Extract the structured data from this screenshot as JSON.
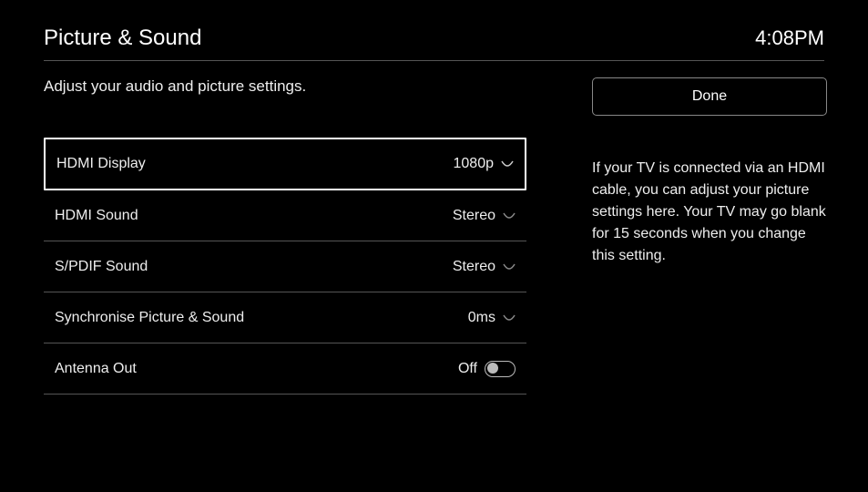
{
  "header": {
    "title": "Picture & Sound",
    "clock": "4:08PM"
  },
  "subtitle": "Adjust your audio and picture settings.",
  "settings": {
    "hdmi_display": {
      "label": "HDMI Display",
      "value": "1080p"
    },
    "hdmi_sound": {
      "label": "HDMI Sound",
      "value": "Stereo"
    },
    "spdif_sound": {
      "label": "S/PDIF Sound",
      "value": "Stereo"
    },
    "sync": {
      "label": "Synchronise Picture & Sound",
      "value": "0ms"
    },
    "antenna": {
      "label": "Antenna Out",
      "value": "Off"
    }
  },
  "done_label": "Done",
  "help_text": "If your TV is connected via an HDMI cable, you can adjust your picture settings here. Your TV may go blank for 15 seconds when you change this setting."
}
